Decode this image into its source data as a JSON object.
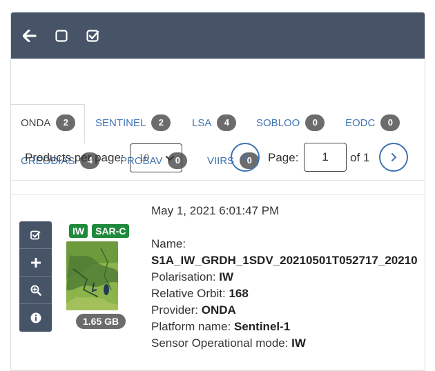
{
  "toolbar": {
    "icons": [
      "arrow-left-icon",
      "square-icon",
      "check-square-icon"
    ]
  },
  "tabs": [
    {
      "label": "ONDA",
      "count": "2",
      "active": true
    },
    {
      "label": "SENTINEL",
      "count": "2",
      "active": false
    },
    {
      "label": "LSA",
      "count": "4",
      "active": false
    },
    {
      "label": "SOBLOO",
      "count": "0",
      "active": false
    },
    {
      "label": "EODC",
      "count": "0",
      "active": false
    },
    {
      "label": "CREODIAS",
      "count": "4",
      "active": false
    },
    {
      "label": "PROBAV",
      "count": "0",
      "active": false
    },
    {
      "label": "VIIRS",
      "count": "0",
      "active": false
    }
  ],
  "pagination": {
    "per_page_label": "Products per page:",
    "per_page_value": "10",
    "page_label": "Page:",
    "page_value": "1",
    "of_label": "of 1"
  },
  "product": {
    "date": "May 1, 2021 6:01:47 PM",
    "badges": [
      "IW",
      "SAR-C"
    ],
    "size": "1.65 GB",
    "name_label": "Name:",
    "name_value": "S1A_IW_GRDH_1SDV_20210501T052717_20210",
    "fields": [
      {
        "label": "Polarisation: ",
        "value": "IW"
      },
      {
        "label": "Relative Orbit: ",
        "value": "168"
      },
      {
        "label": "Provider: ",
        "value": "ONDA"
      },
      {
        "label": "Platform name: ",
        "value": "Sentinel-1"
      },
      {
        "label": "Sensor Operational mode: ",
        "value": "IW"
      }
    ],
    "actions": [
      "check-square-icon",
      "plus-icon",
      "zoom-in-icon",
      "info-icon"
    ]
  },
  "colors": {
    "header": "#475468",
    "link": "#3e74b4",
    "count_badge": "#6c6c6c",
    "green_badge": "#1f8a3b"
  }
}
